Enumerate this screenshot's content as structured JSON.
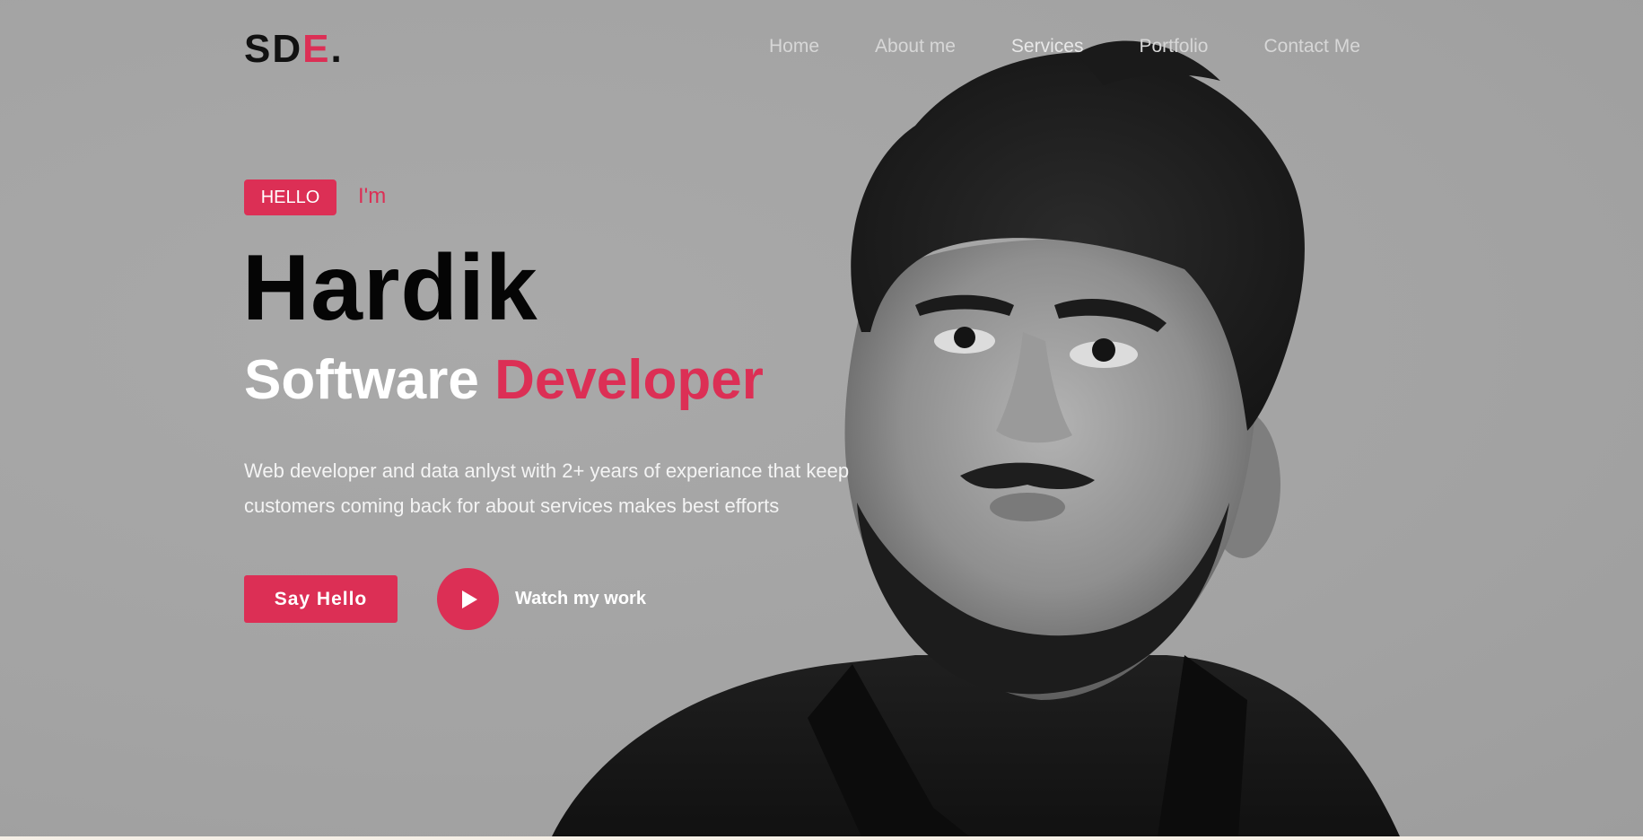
{
  "header": {
    "logo": {
      "part1": "SD",
      "part2": "E",
      "part3": "."
    },
    "nav": [
      {
        "label": "Home"
      },
      {
        "label": "About me"
      },
      {
        "label": "Services"
      },
      {
        "label": "Portfolio"
      },
      {
        "label": "Contact Me"
      }
    ]
  },
  "hero": {
    "badge": "HELLO",
    "intro": "I'm",
    "name": "Hardik",
    "role_main": "Software ",
    "role_accent": "Developer",
    "description": "Web developer and data anlyst with 2+ years of experiance that keep customers coming back for about services makes best efforts",
    "primary_button": "Say Hello",
    "secondary_button": "Watch my work"
  },
  "colors": {
    "accent": "#dc2f55",
    "background": "#a4a4a4",
    "text_dark": "#050505",
    "text_light": "#ffffff"
  },
  "icons": {
    "play": "play-icon",
    "portrait": "portrait-photo"
  }
}
